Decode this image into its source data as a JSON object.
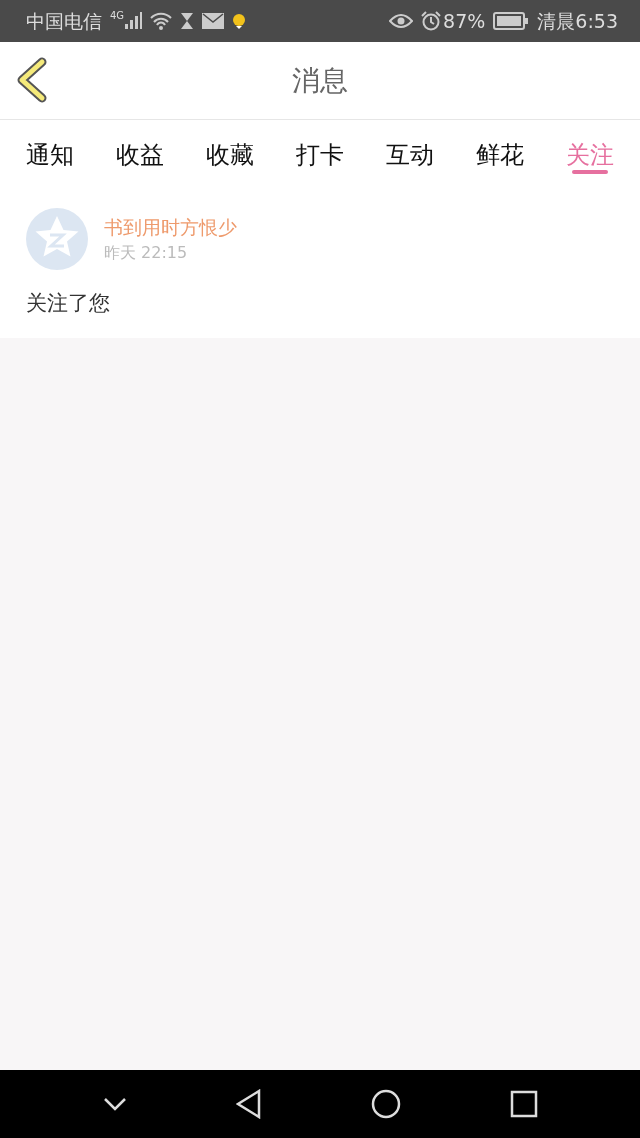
{
  "status_bar": {
    "carrier": "中国电信",
    "network": "4G",
    "battery": "87%",
    "time": "清晨6:53"
  },
  "header": {
    "title": "消息"
  },
  "tabs": [
    {
      "label": "通知",
      "selected": false
    },
    {
      "label": "收益",
      "selected": false
    },
    {
      "label": "收藏",
      "selected": false
    },
    {
      "label": "打卡",
      "selected": false
    },
    {
      "label": "互动",
      "selected": false
    },
    {
      "label": "鲜花",
      "selected": false
    },
    {
      "label": "关注",
      "selected": true
    }
  ],
  "messages": [
    {
      "user": "书到用时方恨少",
      "time": "昨天 22:15",
      "text": "关注了您"
    }
  ]
}
